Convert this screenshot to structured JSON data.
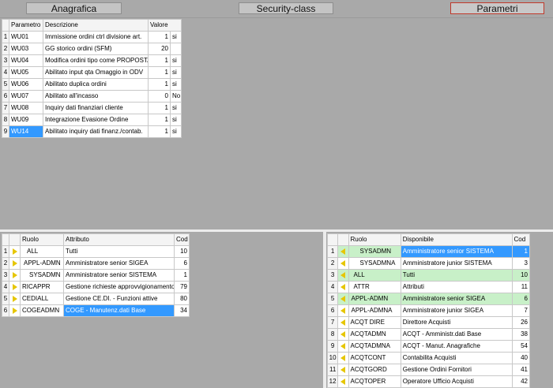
{
  "tabs": [
    {
      "label": "Anagrafica"
    },
    {
      "label": "Security-class"
    },
    {
      "label": "Parametri"
    }
  ],
  "params": {
    "headers": {
      "col1": "Parametro",
      "col2": "Descrizione",
      "col3": "Valore"
    },
    "rows": [
      {
        "n": "1",
        "code": "WU01",
        "desc": "Immissione ordini ctrl divisione art.",
        "val": "1",
        "flag": "si"
      },
      {
        "n": "2",
        "code": "WU03",
        "desc": "GG storico ordini (SFM)",
        "val": "20",
        "flag": ""
      },
      {
        "n": "3",
        "code": "WU04",
        "desc": "Modifica ordini tipo come PROPOSTA",
        "val": "1",
        "flag": "si"
      },
      {
        "n": "4",
        "code": "WU05",
        "desc": "Abilitato input qta Omaggio in ODV",
        "val": "1",
        "flag": "si"
      },
      {
        "n": "5",
        "code": "WU06",
        "desc": "Abilitato duplica ordini",
        "val": "1",
        "flag": "si"
      },
      {
        "n": "6",
        "code": "WU07",
        "desc": "Abilitato all'incasso",
        "val": "0",
        "flag": "No"
      },
      {
        "n": "7",
        "code": "WU08",
        "desc": "Inquiry dati finanziari cliente",
        "val": "1",
        "flag": "si"
      },
      {
        "n": "8",
        "code": "WU09",
        "desc": "Integrazione Evasione Ordine",
        "val": "1",
        "flag": "si"
      },
      {
        "n": "9",
        "code": "WU14",
        "desc": "Abilitato inquiry dati finanz./contab.",
        "val": "1",
        "flag": "si"
      }
    ]
  },
  "roles_left": {
    "headers": {
      "col1": "Ruolo",
      "col2": "Attributo",
      "col3": "Cod"
    },
    "rows": [
      {
        "n": "1",
        "role": "ALL",
        "attr": "Tutti",
        "cod": "10"
      },
      {
        "n": "2",
        "role": "APPL-ADMN",
        "attr": "Amministratore senior SIGEA",
        "cod": "6"
      },
      {
        "n": "3",
        "role": "SYSADMN",
        "attr": "Amministratore senior SISTEMA",
        "cod": "1"
      },
      {
        "n": "4",
        "role": "RICAPPR",
        "attr": "Gestione richieste approvvigionamento",
        "cod": "79"
      },
      {
        "n": "5",
        "role": "CEDIALL",
        "attr": "Gestione CE.DI. - Funzioni attive",
        "cod": "80"
      },
      {
        "n": "6",
        "role": "COGEADMN",
        "attr": "COGE - Manutenz.dati Base",
        "cod": "34"
      }
    ]
  },
  "roles_right": {
    "headers": {
      "col1": "Ruolo",
      "col2": "Disponibile",
      "col3": "Cod"
    },
    "rows": [
      {
        "n": "1",
        "role": "SYSADMN",
        "disp": "Amministratore senior SISTEMA",
        "cod": "1"
      },
      {
        "n": "2",
        "role": "SYSADMNA",
        "disp": "Amministratore junior SISTEMA",
        "cod": "3"
      },
      {
        "n": "3",
        "role": "ALL",
        "disp": "Tutti",
        "cod": "10"
      },
      {
        "n": "4",
        "role": "ATTR",
        "disp": "Attributi",
        "cod": "11"
      },
      {
        "n": "5",
        "role": "APPL-ADMN",
        "disp": "Amministratore senior SIGEA",
        "cod": "6"
      },
      {
        "n": "6",
        "role": "APPL-ADMNA",
        "disp": "Amministratore junior SIGEA",
        "cod": "7"
      },
      {
        "n": "7",
        "role": "ACQT DIRE",
        "disp": "Direttore Acquisti",
        "cod": "26"
      },
      {
        "n": "8",
        "role": "ACQTADMN",
        "disp": "ACQT - Amministr.dati Base",
        "cod": "38"
      },
      {
        "n": "9",
        "role": "ACQTADMNA",
        "disp": "ACQT - Manut. Anagrafiche",
        "cod": "54"
      },
      {
        "n": "10",
        "role": "ACQTCONT",
        "disp": "Contabilita Acquisti",
        "cod": "40"
      },
      {
        "n": "11",
        "role": "ACQTGORD",
        "disp": "Gestione Ordini Fornitori",
        "cod": "41"
      },
      {
        "n": "12",
        "role": "ACQTOPER",
        "disp": "Operatore Ufficio Acquisti",
        "cod": "42"
      }
    ]
  },
  "colors": {
    "selection": "#3399ff",
    "green_row": "#c8f0c8",
    "arrow": "#e6c600",
    "active_tab_border": "#c0392b"
  }
}
